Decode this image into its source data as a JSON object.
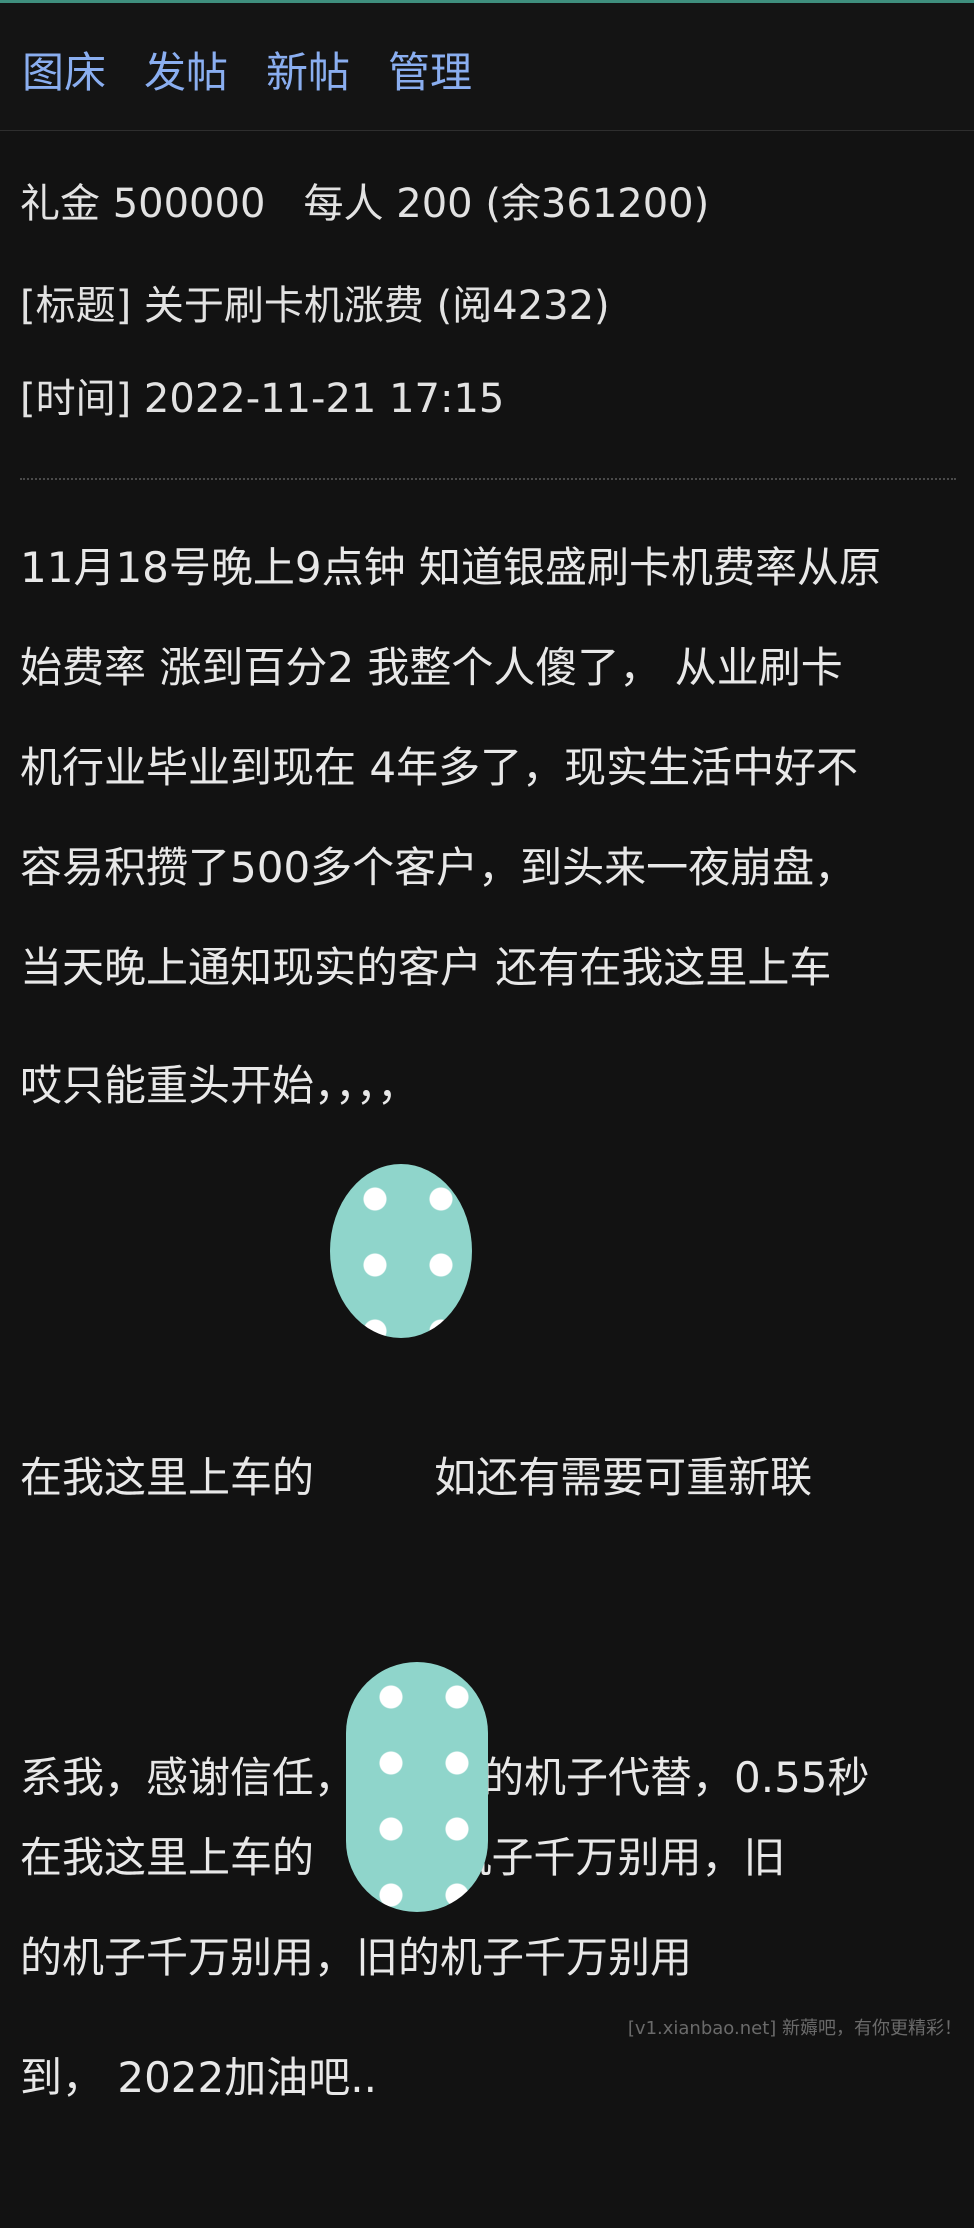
{
  "nav": {
    "links": [
      "图床",
      "发帖",
      "新帖",
      "管理"
    ]
  },
  "meta": {
    "gift": "礼金 500000   每人 200 (余361200)",
    "title": "[标题] 关于刷卡机涨费 (阅4232)",
    "time": "[时间] 2022-11-21 17:15"
  },
  "post": {
    "para1": [
      "11月18号晚上9点钟 知道银盛刷卡机费率从原",
      "始费率 涨到百分2 我整个人傻了， 从业刷卡",
      "机行业毕业到现在 4年多了，现实生活中好不",
      "容易积攒了500多个客户，到头来一夜崩盘，",
      "当天晚上通知现实的客户 还有在我这里上车"
    ],
    "para2": "哎只能重头开始，，，，",
    "para3": [
      "在我这里上车的         如还有需要可重新联",
      "系我，感谢信任，已有新的机子代替，0.55秒",
      "到， 2022加油吧.."
    ],
    "para4": [
      "在我这里上车的       的机子千万别用，旧",
      "的机子千万别用，旧的机子千万别用"
    ]
  },
  "watermark": "[v1.xianbao.net] 新薅吧，有你更精彩！",
  "colors": {
    "background": "#121212",
    "accent_line": "#3f8f7e",
    "link": "#8aaef0",
    "text": "#e8e8e8",
    "sticker": "#8fd5cb"
  }
}
